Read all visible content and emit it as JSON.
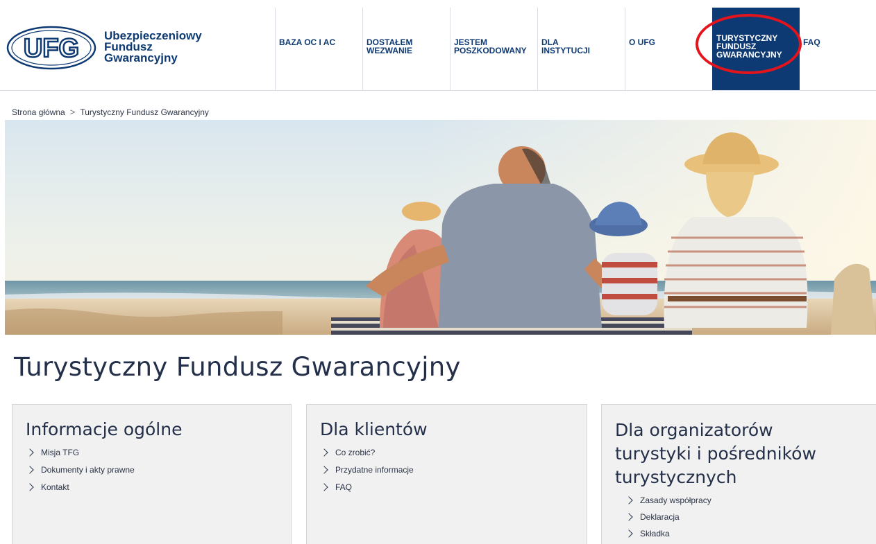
{
  "brand": {
    "logo_letters": "UFG",
    "name_line1": "Ubezpieczeniowy",
    "name_line2": "Fundusz",
    "name_line3": "Gwarancyjny",
    "color": "#0e3a73"
  },
  "nav": {
    "items": [
      {
        "line1": "BAZA OC I AC",
        "line2": ""
      },
      {
        "line1": "DOSTAŁEM",
        "line2": "WEZWANIE"
      },
      {
        "line1": "JESTEM",
        "line2": "POSZKODOWANY"
      },
      {
        "line1": "DLA",
        "line2": "INSTYTUCJI"
      },
      {
        "line1": "O UFG",
        "line2": ""
      },
      {
        "line1": "TURYSTYCZNY",
        "line2": "FUNDUSZ",
        "line3": "GWARANCYJNY"
      },
      {
        "line1": "FAQ",
        "line2": ""
      }
    ],
    "active_index": 5,
    "active_color": "#0e3a73",
    "highlight_color": "#e3141c"
  },
  "breadcrumb": {
    "home": "Strona główna",
    "separator": ">",
    "current": "Turystyczny Fundusz Gwarancyjny"
  },
  "page": {
    "title": "Turystyczny Fundusz Gwarancyjny"
  },
  "cards": [
    {
      "title": "Informacje ogólne",
      "links": [
        "Misja TFG",
        "Dokumenty i akty prawne",
        "Kontakt"
      ]
    },
    {
      "title": "Dla klientów",
      "links": [
        "Co zrobić?",
        "Przydatne informacje",
        "FAQ"
      ]
    },
    {
      "title_line1": "Dla organizatorów",
      "title_line2": "turystyki i pośredników",
      "title_line3": "turystycznych",
      "links": [
        "Zasady współpracy",
        "Deklaracja",
        "Składka"
      ]
    }
  ]
}
